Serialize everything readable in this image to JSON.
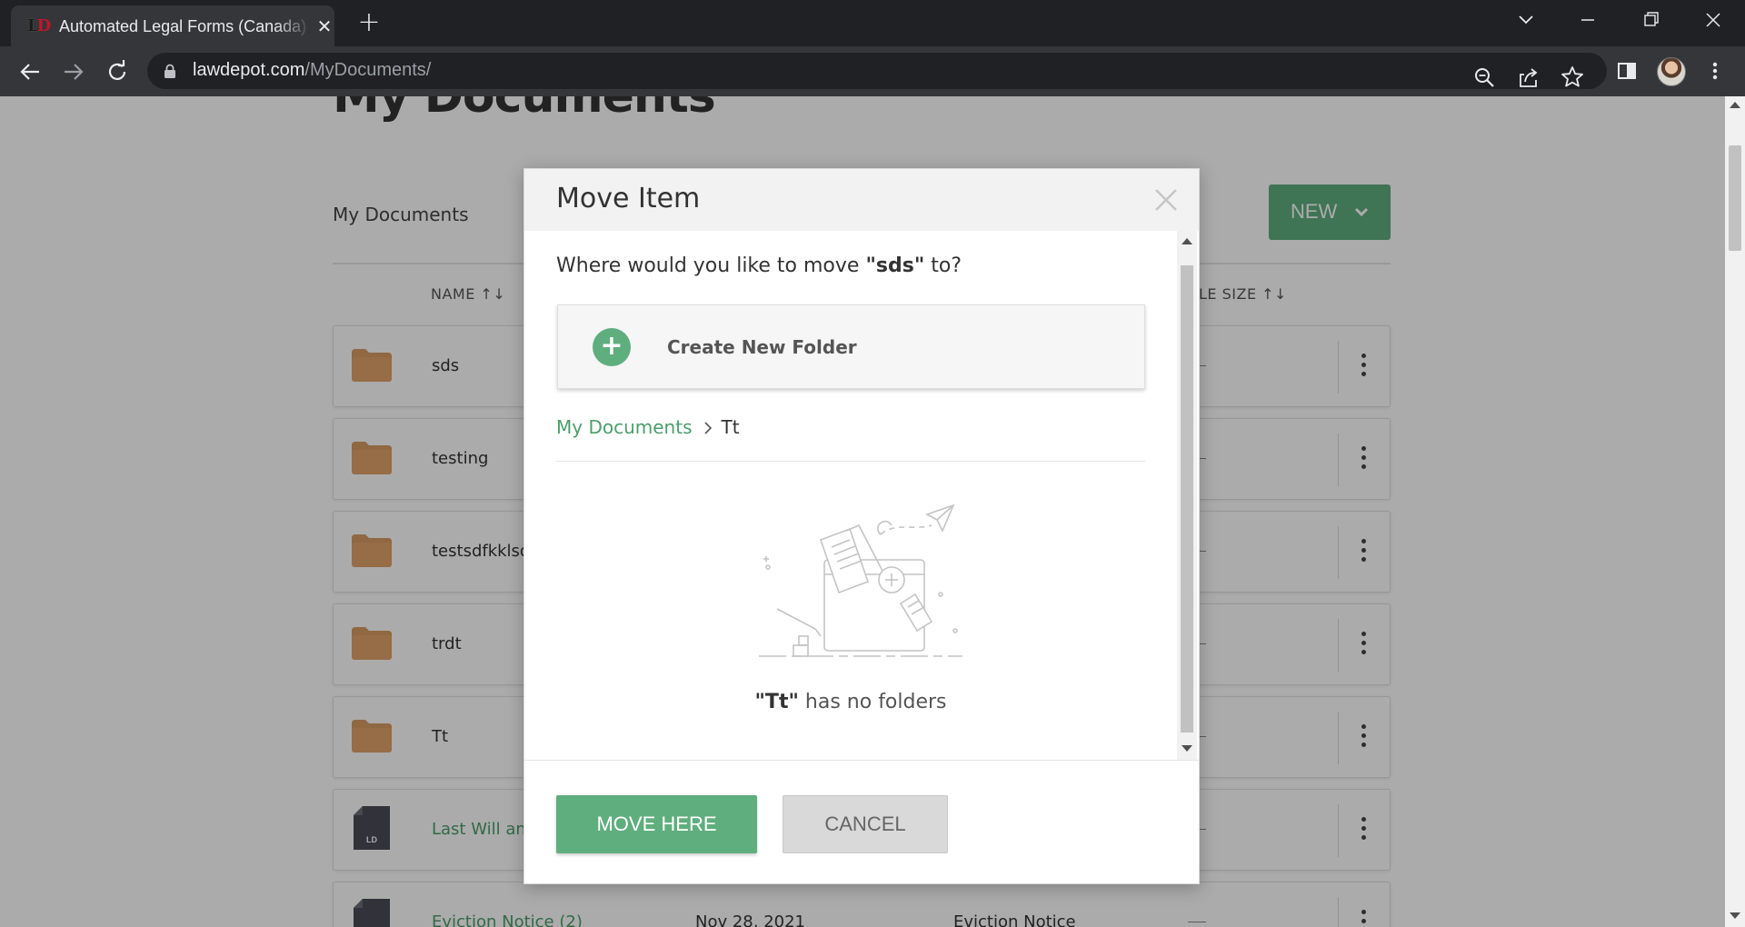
{
  "browser": {
    "tab_title": "Automated Legal Forms (Canada)",
    "url_host": "lawdepot.com",
    "url_path": "/MyDocuments/"
  },
  "page": {
    "heading": "My Documents",
    "breadcrumb": "My Documents",
    "new_button": "NEW",
    "col_name": "NAME ↑↓",
    "col_size": "LE SIZE ↑↓",
    "rows": [
      {
        "name": "sds",
        "kind": "folder"
      },
      {
        "name": "testing",
        "kind": "folder"
      },
      {
        "name": "testsdfkklsdjf",
        "kind": "folder"
      },
      {
        "name": "trdt",
        "kind": "folder"
      },
      {
        "name": "Tt",
        "kind": "folder"
      },
      {
        "name": "Last Will and",
        "kind": "document"
      },
      {
        "name": "Eviction Notice (2)",
        "kind": "document",
        "date": "Nov 28, 2021",
        "type": "Eviction Notice"
      }
    ],
    "doc_badge": "LD"
  },
  "modal": {
    "title": "Move Item",
    "question_prefix": "Where would you like to move ",
    "item": "\"sds\"",
    "question_suffix": " to?",
    "create_folder": "Create New Folder",
    "breadcrumb_root": "My Documents",
    "breadcrumb_leaf": "Tt",
    "empty_folder": "\"Tt\"",
    "empty_suffix": " has no folders",
    "move_button": "MOVE HERE",
    "cancel_button": "CANCEL"
  },
  "colors": {
    "accent": "#5fae7e",
    "link": "#4b9e6b",
    "folder": "#e0a36a",
    "brand_red": "#c0162b"
  }
}
